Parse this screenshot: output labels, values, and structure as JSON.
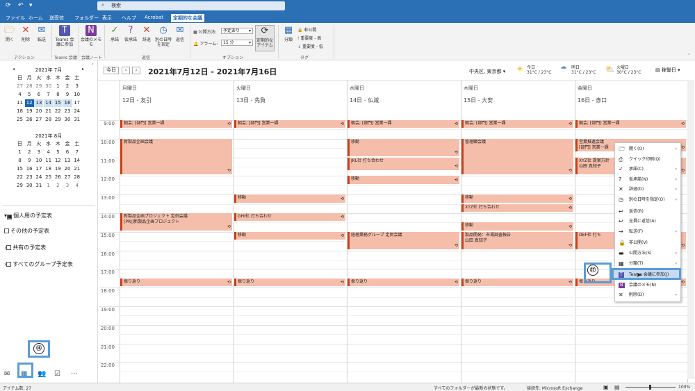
{
  "search": {
    "placeholder": "検索"
  },
  "menu": [
    "ファイル",
    "ホーム",
    "送受信",
    "フォルダー",
    "表示",
    "ヘルプ",
    "Acrobat",
    "定期的な会議"
  ],
  "ribbon": {
    "open": "開く",
    "delete": "削除",
    "forward": "転送",
    "teams_join": "Teams 会\n議に参加",
    "meeting_notes": "会議のメモ\nモ",
    "accept": "承諾",
    "tentative": "仮承諾",
    "decline": "辞退",
    "propose": "別の日時\nを指定",
    "reply": "返信",
    "show_as_label": "公開方法:",
    "show_as_value": "予定あり",
    "alarm_label": "アラーム:",
    "alarm_value": "15 分",
    "recurrence": "定期的な\nアイテム",
    "categorize": "分類",
    "private": "非公開",
    "high": "重要度 - 高",
    "low": "重要度 - 低",
    "groups": {
      "action": "アクション",
      "teams": "Teams 会議",
      "notes": "会議ノート",
      "reply": "返信",
      "options": "オプション",
      "tags": "タグ"
    }
  },
  "navigation": {
    "july_title": "2021年 7月",
    "aug_title": "2021年 8月",
    "weekdays": [
      "日",
      "月",
      "火",
      "水",
      "木",
      "金",
      "土"
    ],
    "july": [
      [
        "27",
        "28",
        "29",
        "30",
        "1",
        "2",
        "3"
      ],
      [
        "4",
        "5",
        "6",
        "7",
        "8",
        "9",
        "10"
      ],
      [
        "11",
        "12",
        "13",
        "14",
        "15",
        "16",
        "17"
      ],
      [
        "18",
        "19",
        "20",
        "21",
        "22",
        "23",
        "24"
      ],
      [
        "25",
        "26",
        "27",
        "28",
        "29",
        "30",
        "31"
      ]
    ],
    "aug": [
      [
        "1",
        "2",
        "3",
        "4",
        "5",
        "6",
        "7"
      ],
      [
        "8",
        "9",
        "10",
        "11",
        "12",
        "13",
        "14"
      ],
      [
        "15",
        "16",
        "17",
        "18",
        "19",
        "20",
        "21"
      ],
      [
        "22",
        "23",
        "24",
        "25",
        "26",
        "27",
        "28"
      ],
      [
        "29",
        "30",
        "31",
        "1",
        "2",
        "3",
        "4"
      ]
    ],
    "tree": [
      "個人用の予定表",
      "その他の予定表",
      "共有の予定表",
      "すべてのグループ予定表"
    ]
  },
  "calendar": {
    "today_btn": "今日",
    "range": "2021年7月12日 - 2021年7月16日",
    "location": "中央区, 東京都",
    "weather": [
      {
        "day": "今日",
        "temp": "31°C / 23°C"
      },
      {
        "day": "明日",
        "temp": "31°C / 23°C"
      },
      {
        "day": "火曜日",
        "temp": "30°C / 23°C"
      }
    ],
    "view": "稼働日",
    "days": [
      {
        "name": "月曜日",
        "date": "12日 - 友引"
      },
      {
        "name": "火曜日",
        "date": "13日 - 先負"
      },
      {
        "name": "水曜日",
        "date": "14日 - 仏滅"
      },
      {
        "name": "木曜日",
        "date": "15日 - 大安"
      },
      {
        "name": "金曜日",
        "date": "16日 - 赤口"
      }
    ],
    "times": [
      "9:00",
      "10:00",
      "11:00",
      "12:00",
      "13:00",
      "14:00",
      "15:00",
      "16:00",
      "17:00",
      "18:00",
      "19:00",
      "20:00",
      "21:00",
      "22:00"
    ],
    "events": {
      "morning": "朝会; [部門] 営業一課",
      "mon_1": "新製品企画会議",
      "mon_2": "新製品企画プロジェクト 定例会議\n[PRJ]新製品企画プロジェクト",
      "tue_1": "移動",
      "tue_2": "GHI社 打ち合わせ",
      "tue_3": "移動",
      "wed_1": "移動",
      "wed_2": "JKL社 打ち合わせ",
      "wed_3": "移動",
      "wed_4": "経理業務グループ 定例会議",
      "thu_1": "管理職会議",
      "thu_2": "移動",
      "thu_3": "XYZ社 打ち合わせ",
      "thu_4": "移動",
      "thu_5": "製品開発：市場調査報告\n山田 真知子",
      "fri_1": "営業推進会議\n[部門] 営業一課",
      "fri_2": "XYZ社 提案方針\n山田 真知子",
      "fri_3": "DEF社 打ち",
      "evening": "振り返り"
    }
  },
  "context_menu": [
    "開く(O)",
    "クイック印刷(Q)",
    "承諾(C)",
    "仮承諾(N)",
    "辞退(D)",
    "別の日時を指定(O)",
    "返信(R)",
    "全員に返信(A)",
    "転送(F)",
    "非公開(V)",
    "公開方法(S)",
    "分類(T)",
    "Teams 会議に参加(J)",
    "会議のメモ(N)",
    "削除(D)"
  ],
  "callouts": {
    "c16": "⑯",
    "c17": "⑰"
  },
  "status": {
    "items": "アイテム数: 27",
    "sync": "すべてのフォルダーが最新の状態です。",
    "connect": "接続先: Microsoft Exchange",
    "zoom": "100%"
  }
}
